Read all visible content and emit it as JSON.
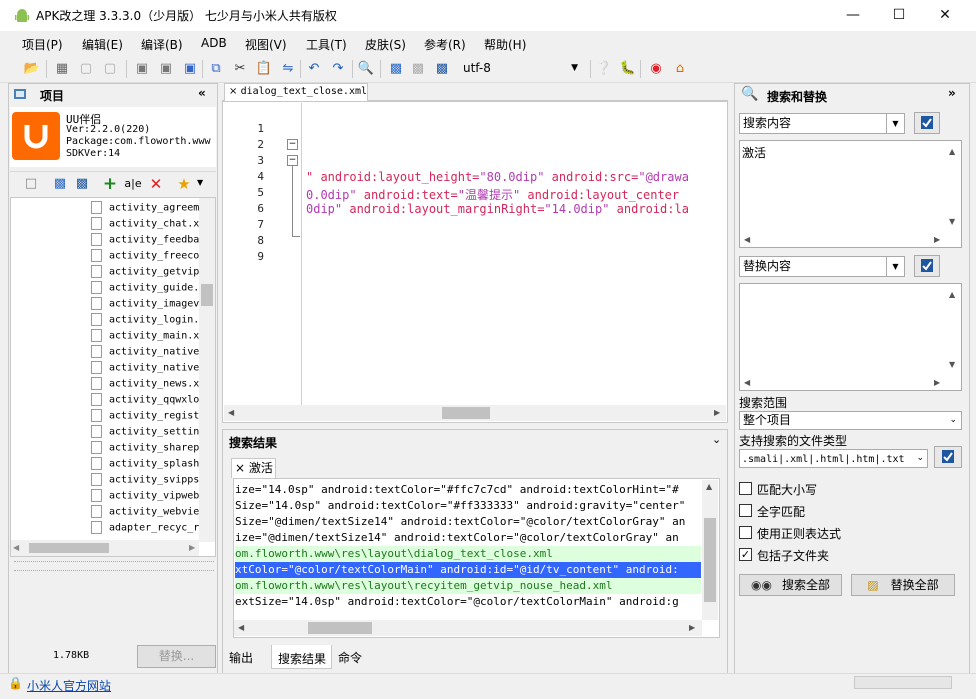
{
  "window": {
    "title": "APK改之理 3.3.3.0（少月版） 七少月与小米人共有版权"
  },
  "menu": [
    "项目(P)",
    "编辑(E)",
    "编译(B)",
    "ADB",
    "视图(V)",
    "工具(T)",
    "皮肤(S)",
    "参考(R)",
    "帮助(H)"
  ],
  "toolbar": {
    "encoding": "utf-8"
  },
  "project_panel": {
    "title": "项目",
    "app_name": "UU伴侣",
    "ver": "Ver:2.2.0(220)",
    "package": "Package:com.floworth.www",
    "sdk": "SDKVer:14",
    "files": [
      "activity_agreem",
      "activity_chat.x",
      "activity_feedba",
      "activity_freeco",
      "activity_getvip",
      "activity_guide.",
      "activity_imagev",
      "activity_login.",
      "activity_main.x",
      "activity_native",
      "activity_native",
      "activity_news.x",
      "activity_qqwxlo",
      "activity_regist",
      "activity_settin",
      "activity_sharep",
      "activity_splash",
      "activity_svipps",
      "activity_vipweb",
      "activity_webvie",
      "adapter_recyc_r"
    ],
    "size": "1.78KB",
    "replace_btn": "替换..."
  },
  "editor": {
    "tab": "dialog_text_close.xml",
    "line_numbers": [
      "1",
      "2",
      "3",
      "4",
      "5",
      "6",
      "7",
      "8",
      "9"
    ],
    "line5": {
      "a": "\" android:layout_height=",
      "b": "\"80.0dip\"",
      "c": " android:src=",
      "d": "\"@drawa"
    },
    "line6": {
      "a": "0.0dip\"",
      "b": " android:text=",
      "c": "\"温馨提示\"",
      "d": " android:layout_center"
    },
    "line7": {
      "a": "0dip\"",
      "b": " android:layout_marginRight=",
      "c": "\"14.0dip\"",
      "d": " android:la"
    }
  },
  "results": {
    "title": "搜索结果",
    "tab": "激活",
    "lines": [
      "ize=\"14.0sp\" android:textColor=\"#ffc7c7cd\" android:textColorHint=\"#",
      "Size=\"14.0sp\" android:textColor=\"#ff333333\" android:gravity=\"center\"",
      "Size=\"@dimen/textSize14\" android:textColor=\"@color/textColorGray\" an",
      "ize=\"@dimen/textSize14\" android:textColor=\"@color/textColorGray\" an",
      "om.floworth.www\\res\\layout\\dialog_text_close.xml",
      "xtColor=\"@color/textColorMain\" android:id=\"@id/tv_content\" android:",
      "om.floworth.www\\res\\layout\\recyitem_getvip_nouse_head.xml",
      "extSize=\"14.0sp\" android:textColor=\"@color/textColorMain\" android:g"
    ],
    "bottom_tabs": [
      "输出",
      "搜索结果",
      "命令"
    ]
  },
  "search_panel": {
    "title": "搜索和替换",
    "search_label": "搜索内容",
    "search_value": "激活",
    "replace_label": "替换内容",
    "scope_label": "搜索范围",
    "scope_value": "整个项目",
    "filetypes_label": "支持搜索的文件类型",
    "filetypes_value": ".smali|.xml|.html|.htm|.txt",
    "options": [
      {
        "label": "匹配大小写",
        "checked": false
      },
      {
        "label": "全字匹配",
        "checked": false
      },
      {
        "label": "使用正则表达式",
        "checked": false
      },
      {
        "label": "包括子文件夹",
        "checked": true
      }
    ],
    "search_all": "搜索全部",
    "replace_all": "替换全部"
  },
  "status": {
    "link": "小米人官方网站"
  },
  "colors": {
    "accent": "#3399ff",
    "highlight_green": "#ddffdd",
    "selection_blue": "#3366ff",
    "code_pink": "#d2285a",
    "code_purple": "#b33ab3",
    "logo_orange": "#ff6a00"
  }
}
